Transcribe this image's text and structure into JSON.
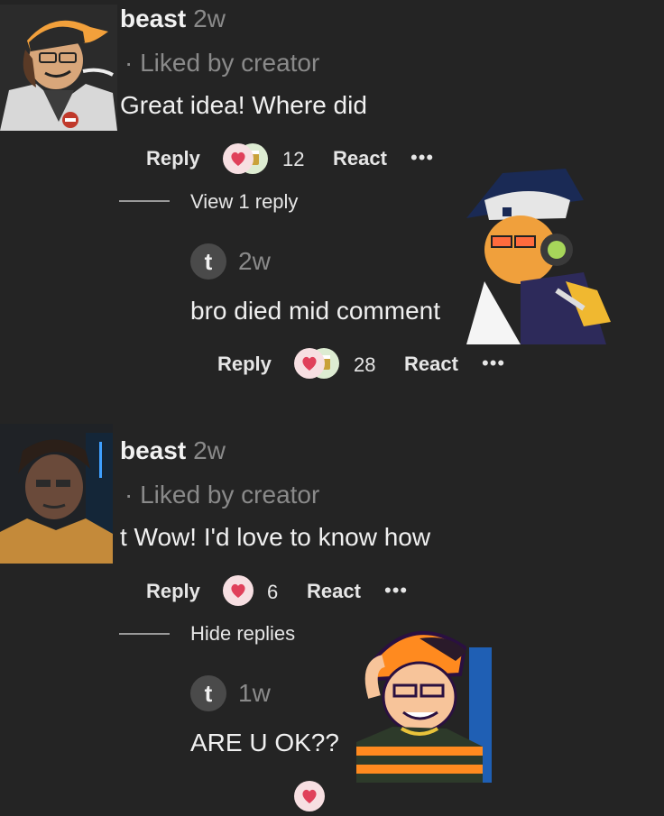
{
  "comments": [
    {
      "username": "beast",
      "time": "2w",
      "liked": "· Liked by creator",
      "text": "Great idea! Where did",
      "reply_label": "Reply",
      "react_count": "12",
      "react_label": "React",
      "more": "•••",
      "replies_toggle": "View 1 reply",
      "reply": {
        "badge": "t",
        "time": "2w",
        "text": "bro died mid comment",
        "reply_label": "Reply",
        "react_count": "28",
        "react_label": "React",
        "more": "•••"
      }
    },
    {
      "username": "beast",
      "time": "2w",
      "liked": "· Liked by creator",
      "text": "t Wow! I'd love to know how",
      "reply_label": "Reply",
      "react_count": "6",
      "react_label": "React",
      "more": "•••",
      "replies_toggle": "Hide replies",
      "reply": {
        "badge": "t",
        "time": "1w",
        "text": "ARE U OK??"
      }
    }
  ],
  "colors": {
    "background": "#242424",
    "muted_text": "#8a8a8a",
    "heart_reaction": "#e0405a",
    "beer_reaction": "#c9a13a"
  },
  "icons": [
    "heart-reaction-icon",
    "beer-reaction-icon",
    "more-dots-icon"
  ]
}
